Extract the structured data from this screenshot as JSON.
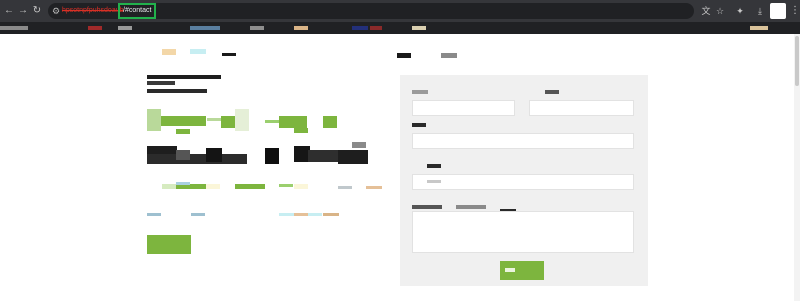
{
  "browser": {
    "url_redacted": "hpsotnpfpuhsdoaub",
    "url_hash": "/#contact",
    "icons": {
      "back": "arrow-left-icon",
      "forward": "arrow-right-icon",
      "reload": "reload-icon",
      "site_info": "tune-icon",
      "translate": "translate-icon",
      "bookmark_star": "star-icon",
      "extensions": "puzzle-icon",
      "downloads": "download-icon",
      "profile": "avatar",
      "menu": "kebab-menu-icon"
    },
    "highlight_color": "#22b14c",
    "redaction_color": "#d93025"
  },
  "page": {
    "accent_color": "#7db53e",
    "form_background": "#f0f0f0",
    "text_note": "All page text is pixelated/obscured in the screenshot and cannot be read."
  }
}
